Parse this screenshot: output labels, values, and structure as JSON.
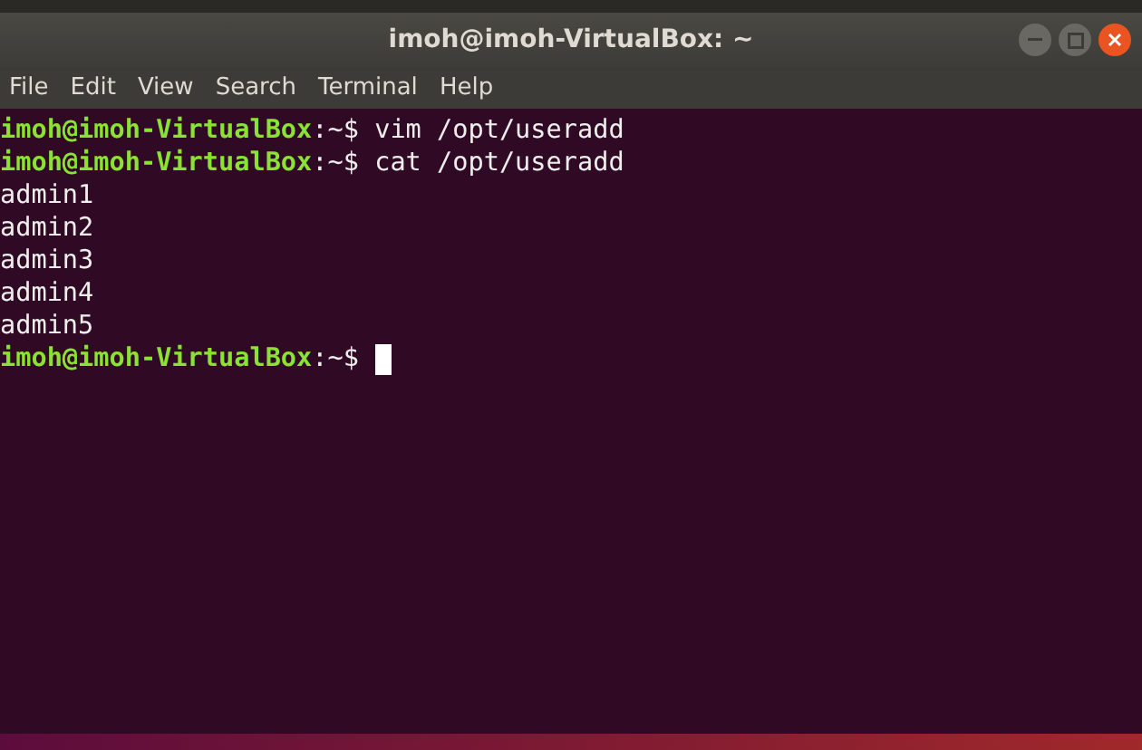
{
  "window": {
    "title": "imoh@imoh-VirtualBox: ~"
  },
  "menu": [
    "File",
    "Edit",
    "View",
    "Search",
    "Terminal",
    "Help"
  ],
  "lines": [
    {
      "kind": "prompt",
      "user_host": "imoh@imoh-VirtualBox",
      "path": ":~$",
      "command": "vim /opt/useradd",
      "cursor": false
    },
    {
      "kind": "prompt",
      "user_host": "imoh@imoh-VirtualBox",
      "path": ":~$",
      "command": "cat /opt/useradd",
      "cursor": false
    },
    {
      "kind": "output",
      "text": "admin1"
    },
    {
      "kind": "output",
      "text": "admin2"
    },
    {
      "kind": "output",
      "text": "admin3"
    },
    {
      "kind": "output",
      "text": "admin4"
    },
    {
      "kind": "output",
      "text": "admin5"
    },
    {
      "kind": "prompt",
      "user_host": "imoh@imoh-VirtualBox",
      "path": ":~$",
      "cursor": true
    }
  ]
}
